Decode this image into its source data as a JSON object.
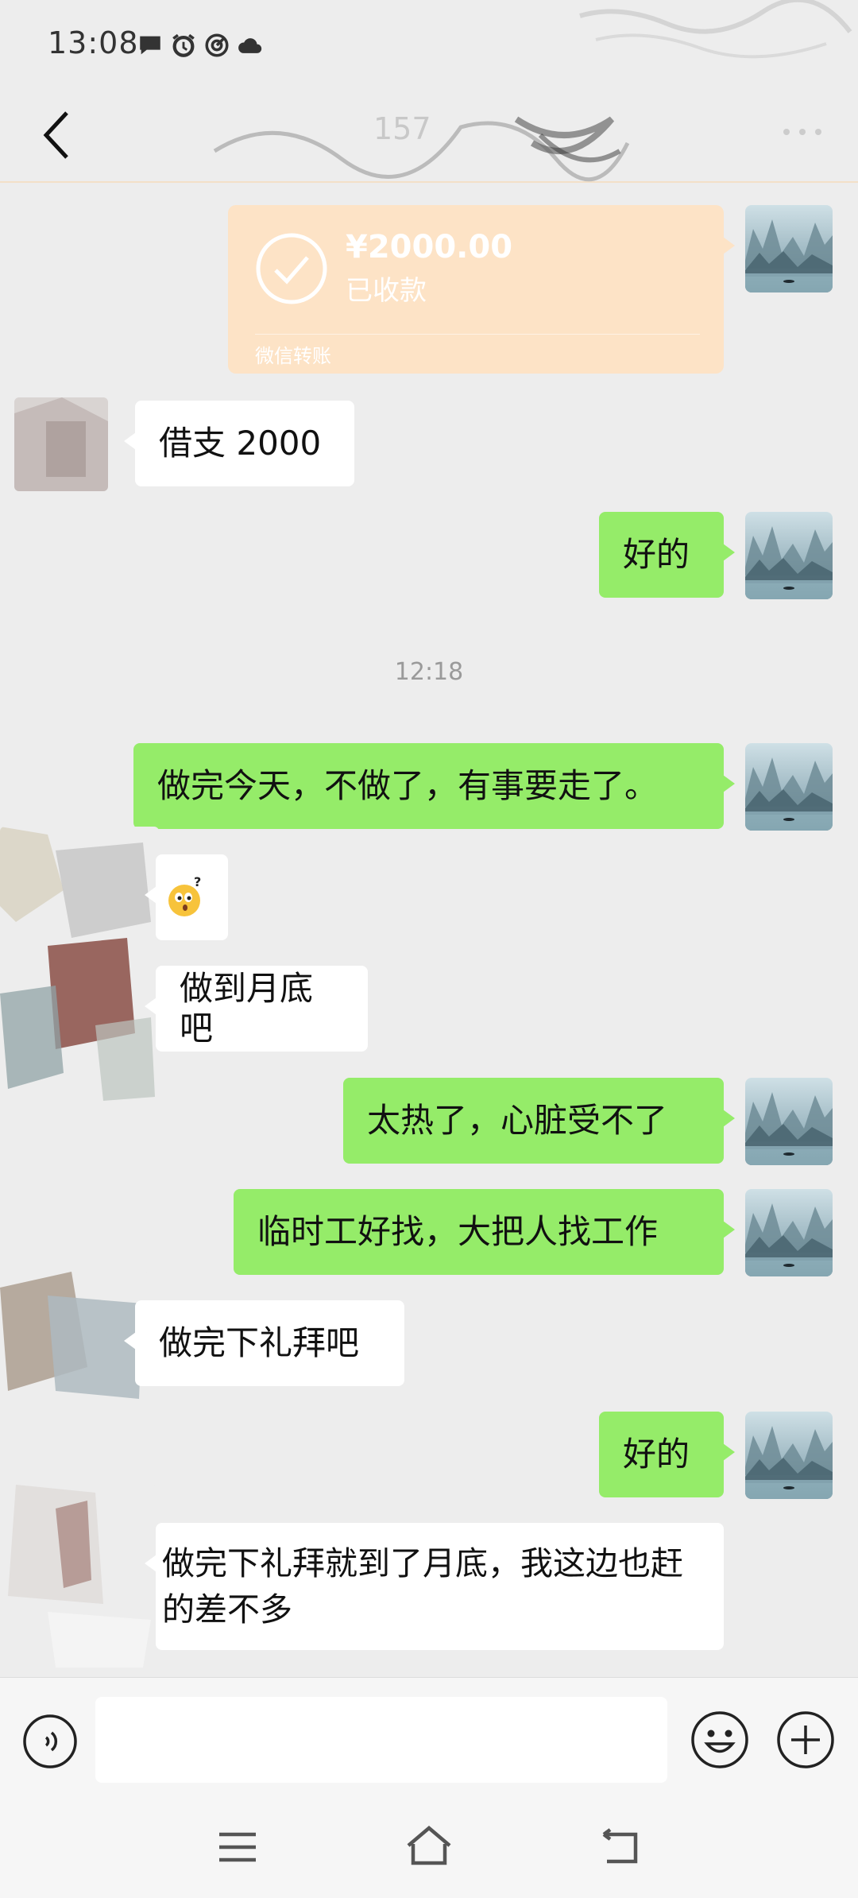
{
  "status_bar": {
    "time": "13:08"
  },
  "header": {
    "contact_name": "157"
  },
  "transfer": {
    "amount": "¥2000.00",
    "status": "已收款",
    "label": "微信转账"
  },
  "messages": {
    "m1": "借支 2000",
    "m2": "好的",
    "m3": "做完今天，不做了，有事要走了。",
    "m4": "做到月底吧",
    "m5": "太热了，心脏受不了",
    "m6": "临时工好找，大把人找工作",
    "m7": "做完下礼拜吧",
    "m8": "好的",
    "m9": "做完下礼拜就到了月底，我这边也赶的差不多"
  },
  "timestamp": "12:18",
  "input": {
    "value": ""
  },
  "colors": {
    "outgoing": "#95ec69",
    "incoming": "#ffffff",
    "transfer": "#fde3c6",
    "background": "#ededed"
  },
  "icons": {
    "status": [
      "message-icon",
      "alarm-icon",
      "target-icon",
      "cloud-icon"
    ],
    "header": [
      "back-icon"
    ],
    "input": [
      "voice-icon",
      "emoji-icon",
      "plus-icon"
    ],
    "nav": [
      "menu-icon",
      "home-icon",
      "nav-back-icon"
    ]
  }
}
